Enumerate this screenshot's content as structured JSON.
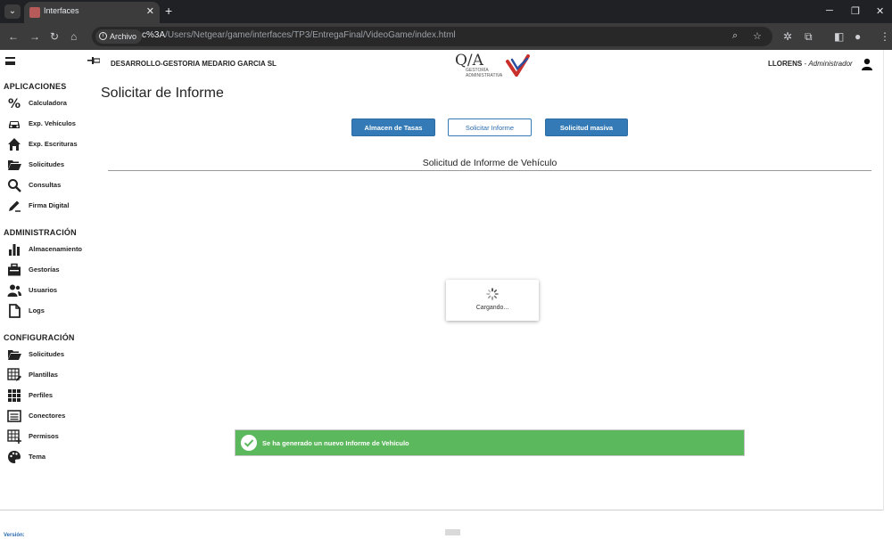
{
  "browser": {
    "tab_title": "Interfaces",
    "tab_close": "✕",
    "new_tab": "+",
    "url_chip": "Archivo",
    "url_path_bold": "c%3A",
    "url_path": "/Users/Netgear/game/interfaces/TP3/EntregaFinal/VideoGame/index.html"
  },
  "header": {
    "company": "DESARROLLO-GESTORIA MEDARIO GARCIA SL",
    "logo_qa": "Q/A",
    "logo_sub1": "GESTORÍA",
    "logo_sub2": "ADMINISTRATIVA",
    "user": "LLORENS",
    "separator": " - ",
    "role": "Administrador"
  },
  "sidebar": {
    "sections": [
      {
        "title": "APLICACIONES",
        "items": [
          {
            "label": "Calculadora",
            "icon": "percent-icon"
          },
          {
            "label": "Exp. Vehículos",
            "icon": "car-icon"
          },
          {
            "label": "Exp. Escrituras",
            "icon": "home-icon"
          },
          {
            "label": "Solicitudes",
            "icon": "folder-open-icon"
          },
          {
            "label": "Consultas",
            "icon": "search-icon"
          },
          {
            "label": "Firma Digital",
            "icon": "pen-icon"
          }
        ]
      },
      {
        "title": "ADMINISTRACIÓN",
        "items": [
          {
            "label": "Almacenamiento",
            "icon": "bar-chart-icon"
          },
          {
            "label": "Gestorías",
            "icon": "briefcase-icon"
          },
          {
            "label": "Usuarios",
            "icon": "users-icon"
          },
          {
            "label": "Logs",
            "icon": "file-icon"
          }
        ]
      },
      {
        "title": "CONFIGURACIÓN",
        "items": [
          {
            "label": "Solicitudes",
            "icon": "folder-open-icon"
          },
          {
            "label": "Plantillas",
            "icon": "table-edit-icon"
          },
          {
            "label": "Perfiles",
            "icon": "grid-icon"
          },
          {
            "label": "Conectores",
            "icon": "list-box-icon"
          },
          {
            "label": "Permisos",
            "icon": "table-add-icon"
          },
          {
            "label": "Tema",
            "icon": "palette-icon"
          }
        ]
      }
    ],
    "version": "Versión:"
  },
  "main": {
    "title": "Solicitar de Informe",
    "buttons": {
      "tasas": "Almacen de Tasas",
      "informe": "Solicitar Informe",
      "masiva": "Solicitud masiva"
    },
    "section_title": "Solicitud de Informe de Vehículo",
    "loading": "Cargando...",
    "alert": "Se ha generado un nuevo Informe de Vehículo"
  },
  "colors": {
    "primary": "#337ab7",
    "success": "#5cb85c",
    "chrome_dark": "#202124"
  }
}
